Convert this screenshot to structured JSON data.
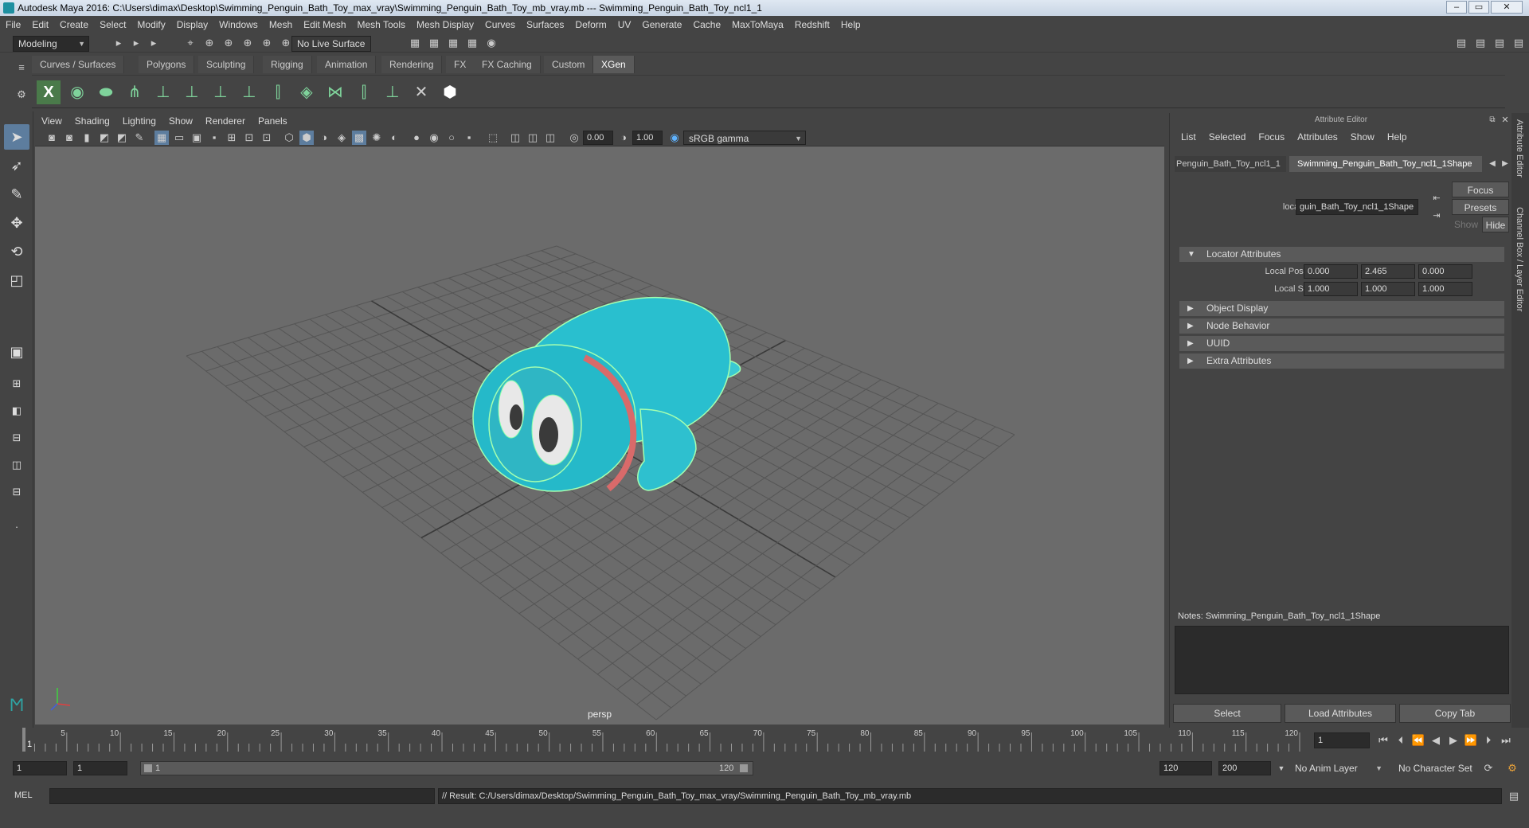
{
  "window": {
    "title": "Autodesk Maya 2016: C:\\Users\\dimax\\Desktop\\Swimming_Penguin_Bath_Toy_max_vray\\Swimming_Penguin_Bath_Toy_mb_vray.mb  ---  Swimming_Penguin_Bath_Toy_ncl1_1"
  },
  "menubar": [
    "File",
    "Edit",
    "Create",
    "Select",
    "Modify",
    "Display",
    "Windows",
    "Mesh",
    "Edit Mesh",
    "Mesh Tools",
    "Mesh Display",
    "Curves",
    "Surfaces",
    "Deform",
    "UV",
    "Generate",
    "Cache",
    "MaxToMaya",
    "Redshift",
    "Help"
  ],
  "statusline": {
    "mode": "Modeling",
    "live_surface": "No Live Surface"
  },
  "shelf_tabs": [
    "Curves / Surfaces",
    "Polygons",
    "Sculpting",
    "Rigging",
    "Animation",
    "Rendering",
    "FX",
    "FX Caching",
    "Custom",
    "XGen"
  ],
  "shelf_active": "XGen",
  "viewport": {
    "menu": [
      "View",
      "Shading",
      "Lighting",
      "Show",
      "Renderer",
      "Panels"
    ],
    "exposure": "0.00",
    "gamma": "1.00",
    "color_space": "sRGB gamma",
    "camera_label": "persp"
  },
  "attribute_editor": {
    "title": "Attribute Editor",
    "menu": [
      "List",
      "Selected",
      "Focus",
      "Attributes",
      "Show",
      "Help"
    ],
    "tab_left": "Penguin_Bath_Toy_ncl1_1",
    "tab_active": "Swimming_Penguin_Bath_Toy_ncl1_1Shape",
    "locator_label": "locator:",
    "locator_value": "guin_Bath_Toy_ncl1_1Shape",
    "buttons": {
      "focus": "Focus",
      "presets": "Presets",
      "show": "Show",
      "hide": "Hide"
    },
    "sections": {
      "locator": "Locator Attributes",
      "object_display": "Object Display",
      "node_behavior": "Node Behavior",
      "uuid": "UUID",
      "extra": "Extra Attributes"
    },
    "local_position": {
      "label": "Local Position",
      "x": "0.000",
      "y": "2.465",
      "z": "0.000"
    },
    "local_scale": {
      "label": "Local Scale",
      "x": "1.000",
      "y": "1.000",
      "z": "1.000"
    },
    "notes_label": "Notes:",
    "notes_value": "Swimming_Penguin_Bath_Toy_ncl1_1Shape",
    "bottom_buttons": {
      "select": "Select",
      "load": "Load Attributes",
      "copy": "Copy Tab"
    },
    "side_tabs": [
      "Attribute Editor",
      "Channel Box / Layer Editor"
    ]
  },
  "timeline": {
    "ticks": [
      "5",
      "10",
      "15",
      "20",
      "25",
      "30",
      "35",
      "40",
      "45",
      "50",
      "55",
      "60",
      "65",
      "70",
      "75",
      "80",
      "85",
      "90",
      "95",
      "100",
      "105",
      "110",
      "115",
      "120"
    ],
    "current_frame_marker": "1",
    "current_frame": "1"
  },
  "range": {
    "start": "1",
    "playback_start": "1",
    "slider_start": "1",
    "slider_end": "120",
    "playback_end": "120",
    "end": "200",
    "anim_layer": "No Anim Layer",
    "character_set": "No Character Set"
  },
  "cmdline": {
    "type": "MEL",
    "result": "// Result: C:/Users/dimax/Desktop/Swimming_Penguin_Bath_Toy_max_vray/Swimming_Penguin_Bath_Toy_mb_vray.mb"
  }
}
